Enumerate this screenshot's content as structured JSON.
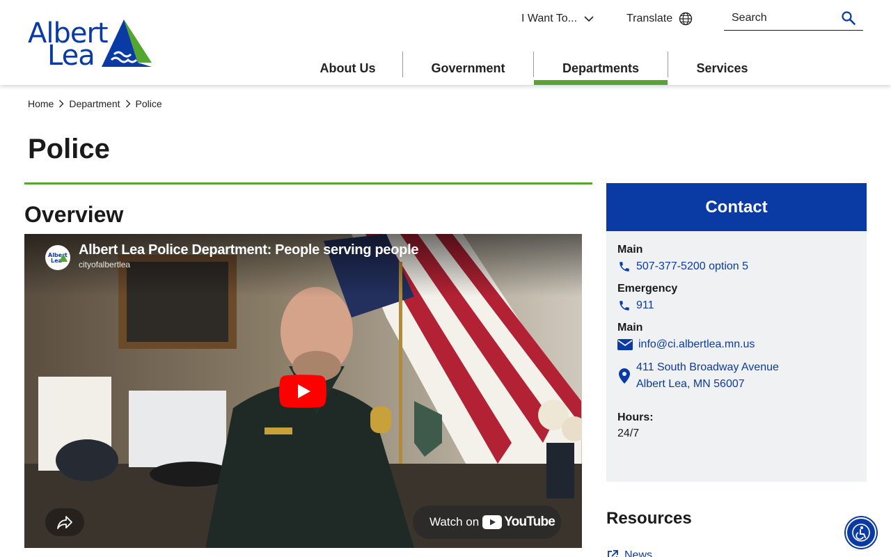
{
  "logo": {
    "line1": "Albert",
    "line2": "Lea"
  },
  "header": {
    "i_want_to": "I Want To...",
    "translate": "Translate",
    "search_placeholder": "Search"
  },
  "nav": {
    "items": [
      {
        "label": "About Us",
        "active": false
      },
      {
        "label": "Government",
        "active": false
      },
      {
        "label": "Departments",
        "active": true
      },
      {
        "label": "Services",
        "active": false
      }
    ]
  },
  "breadcrumb": {
    "items": [
      "Home",
      "Department",
      "Police"
    ]
  },
  "page": {
    "title": "Police",
    "section_title": "Overview"
  },
  "video": {
    "title": "Albert Lea Police Department: People serving people",
    "channel": "cityofalbertlea",
    "watch_on": "Watch on",
    "youtube": "YouTube"
  },
  "contact": {
    "heading": "Contact",
    "main_label": "Main",
    "main_phone": "507-377-5200 option 5",
    "emergency_label": "Emergency",
    "emergency_phone": "911",
    "email_label": "Main",
    "email": "info@ci.albertlea.mn.us",
    "address_line1": "411 South Broadway Avenue",
    "address_line2": "Albert Lea, MN 56007",
    "hours_label": "Hours:",
    "hours_value": "24/7"
  },
  "resources": {
    "heading": "Resources",
    "first_link": "News"
  },
  "colors": {
    "brand_blue": "#0a3aa3",
    "brand_green": "#55a630",
    "panel_gray": "#f0f1f3"
  },
  "icons": [
    "chevron-down-icon",
    "globe-icon",
    "search-icon",
    "phone-icon",
    "envelope-icon",
    "map-pin-icon",
    "play-icon",
    "share-icon",
    "external-link-icon",
    "accessibility-icon"
  ]
}
